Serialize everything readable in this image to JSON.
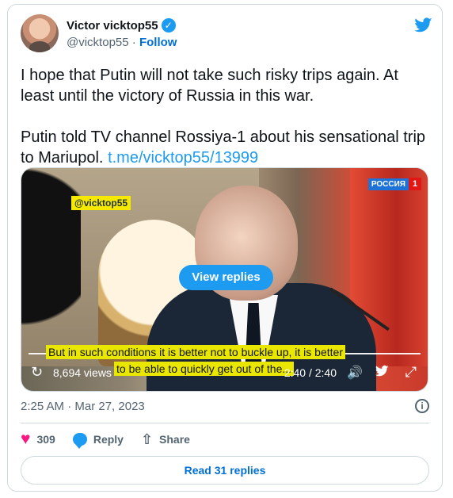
{
  "author": {
    "name": "Victor vicktop55",
    "handle": "@vicktop55",
    "separator": "·",
    "follow_label": "Follow"
  },
  "tweet": {
    "text": "I hope that Putin will not take such risky trips again.  At least until the victory of Russia in this war.\n\nPutin told TV channel Rossiya-1 about his sensational trip to Mariupol. ",
    "link": "t.me/vicktop55/13999"
  },
  "video": {
    "watermark": "@vicktop55",
    "channel_name": "РОССИЯ",
    "channel_number": "1",
    "view_replies_label": "View replies",
    "subtitle_line_1": "But in such conditions it is better not to buckle up, it is better",
    "subtitle_line_2": "to be able to quickly get out of the...",
    "views": "8,694 views",
    "time": "2:40 / 2:40",
    "progress_fraction": 1.0
  },
  "meta": {
    "timestamp": "2:25 AM · Mar 27, 2023",
    "info_icon": "info-icon"
  },
  "actions": {
    "likes": "309",
    "reply_label": "Reply",
    "share_label": "Share"
  },
  "footer": {
    "read_replies_label": "Read 31 replies"
  },
  "colors": {
    "accent": "#1d9bf0",
    "like": "#f91880",
    "text": "#0f1419",
    "muted": "#536471"
  }
}
